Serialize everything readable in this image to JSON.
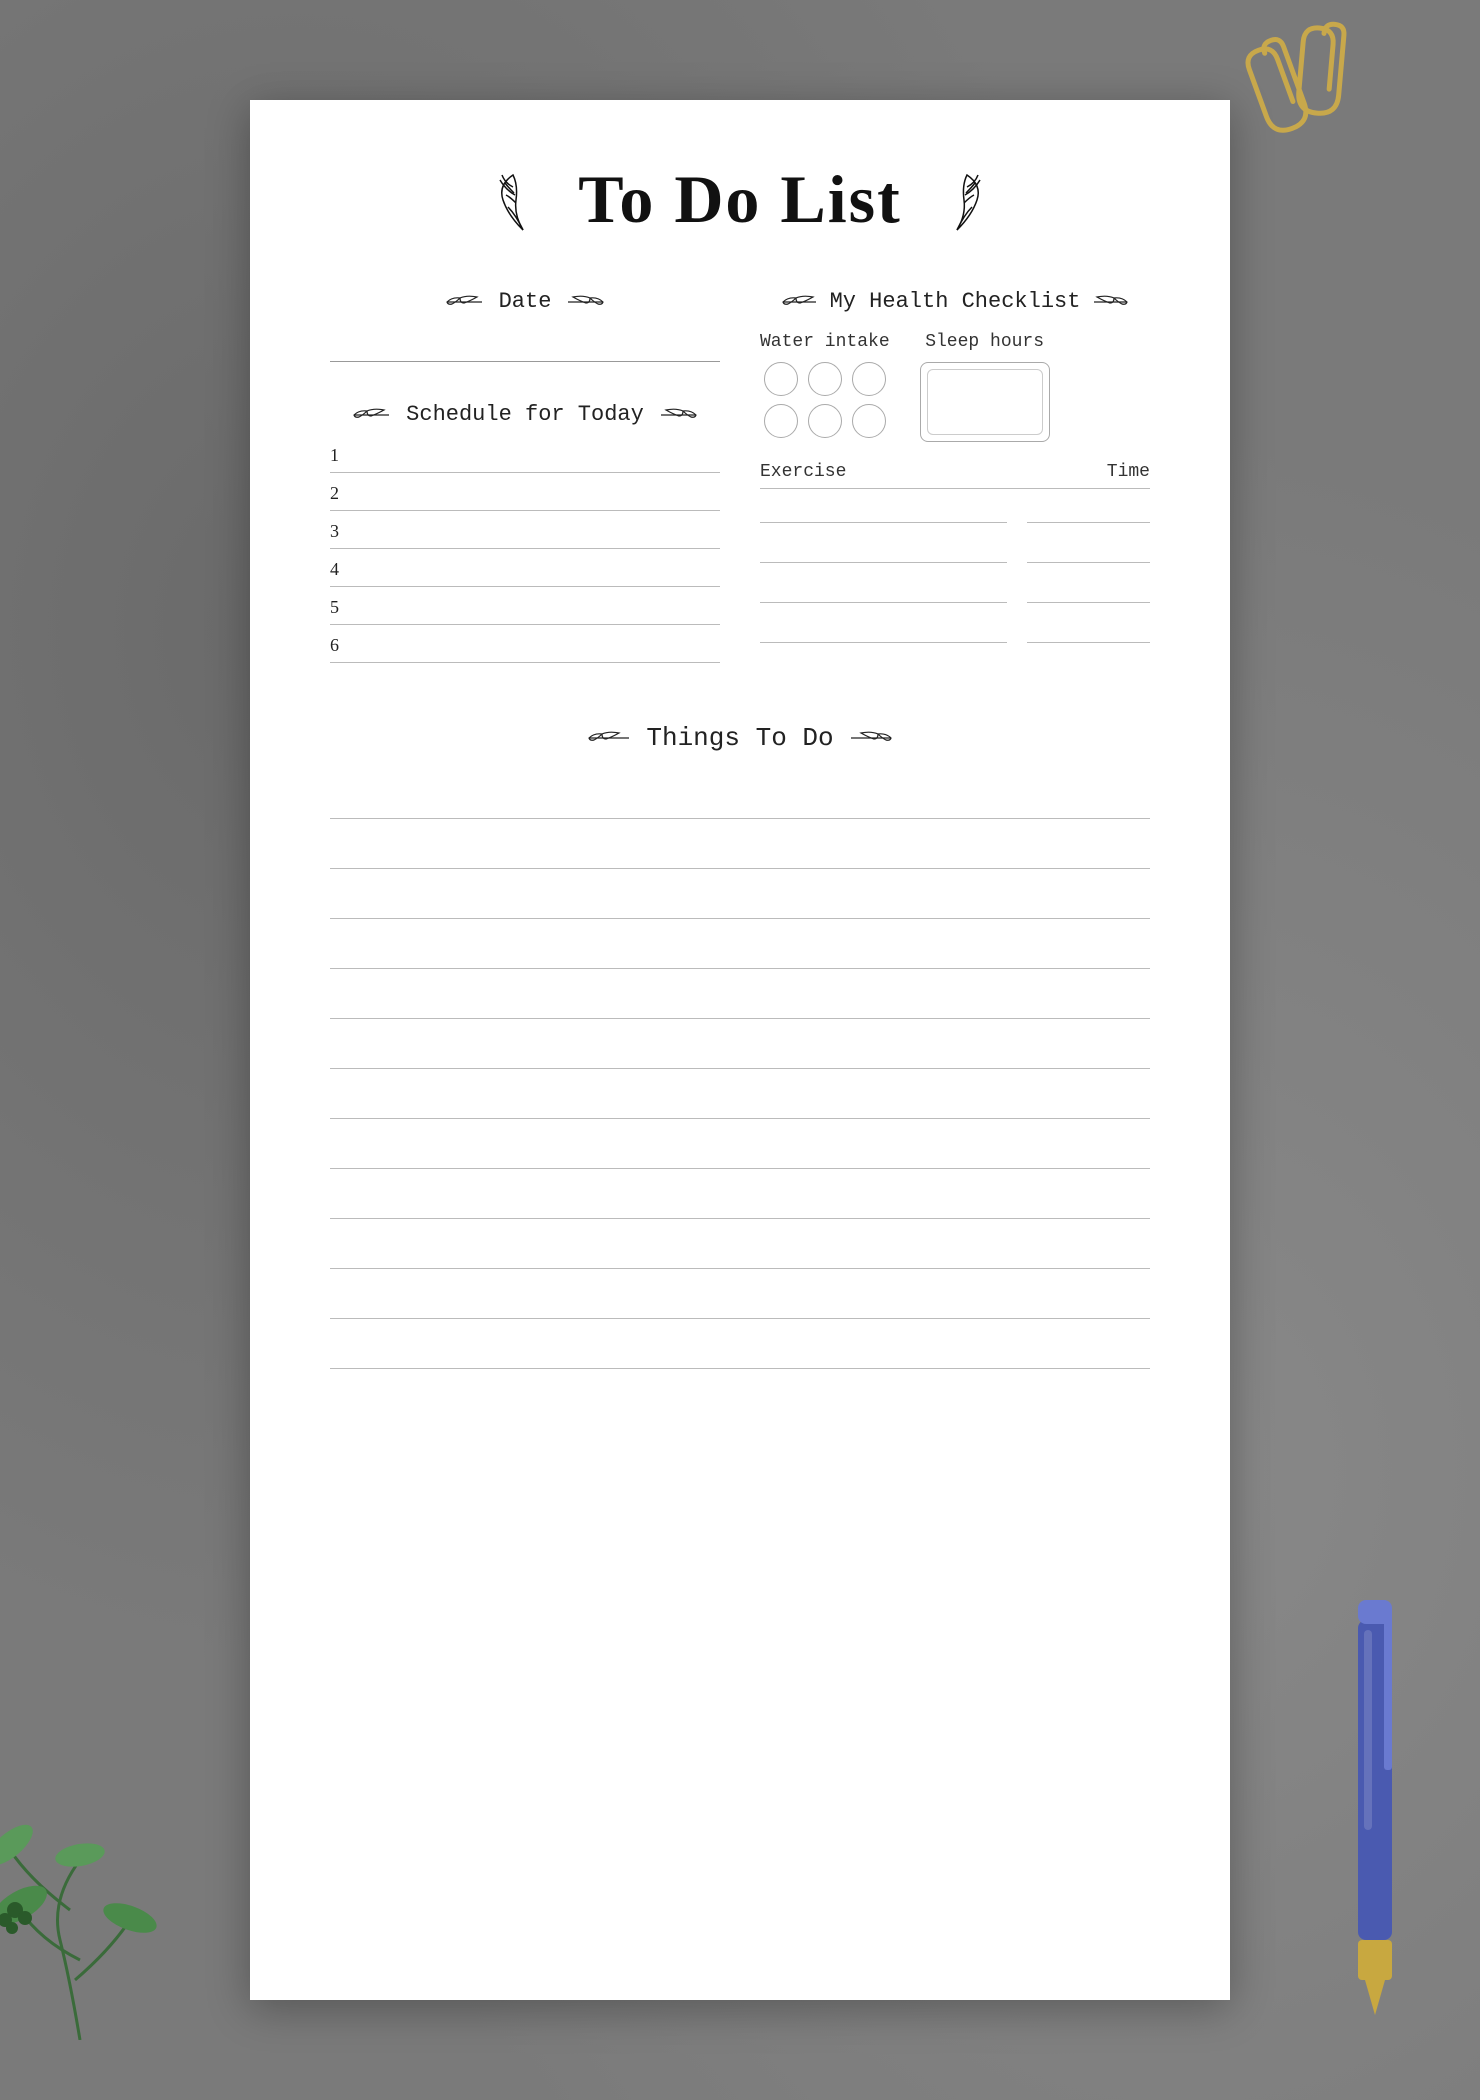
{
  "page": {
    "title": "To Do List",
    "background": "#7a7a7a",
    "paper_bg": "#ffffff"
  },
  "sections": {
    "date": {
      "label": "Date",
      "placeholder": ""
    },
    "schedule": {
      "label": "Schedule for Today",
      "items": [
        "1",
        "2",
        "3",
        "4",
        "5",
        "6"
      ]
    },
    "health": {
      "label": "My Health Checklist",
      "water_intake_label": "Water intake",
      "sleep_hours_label": "Sleep hours",
      "water_circles": 6,
      "exercise_label": "Exercise",
      "time_label": "Time",
      "exercise_rows": 4
    },
    "things": {
      "label": "Things To Do",
      "lines": 12
    }
  },
  "decorations": {
    "leaf_left": "❧",
    "leaf_right": "❧",
    "title_leaf_left": "🌿",
    "title_leaf_right": "🌿"
  }
}
